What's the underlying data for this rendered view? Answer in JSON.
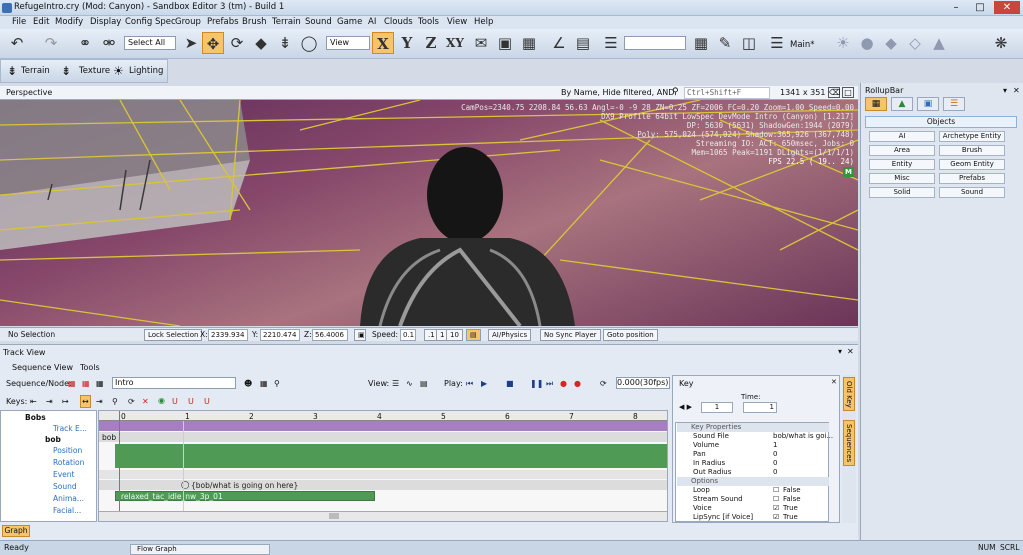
{
  "window": {
    "title": "RefugeIntro.cry (Mod: Canyon) - Sandbox Editor 3 (tm) - Build 1",
    "controls": [
      "minimize-icon",
      "maximize-icon",
      "close-icon"
    ]
  },
  "menu": [
    "File",
    "Edit",
    "Modify",
    "Display",
    "Config Spec",
    "Group",
    "Prefabs",
    "Brush",
    "Terrain",
    "Sound",
    "Game",
    "AI",
    "Clouds",
    "Tools",
    "View",
    "Help"
  ],
  "toolbar": {
    "select_all": "Select All",
    "coord_mode": "View",
    "axis_x": "X",
    "axis_y": "Y",
    "axis_z": "Z",
    "axis_xy": "XY",
    "layer": "Main*"
  },
  "toolbar2": {
    "terrain": "Terrain",
    "texture": "Texture",
    "lighting": "Lighting"
  },
  "viewport": {
    "name": "Perspective",
    "filter": "By Name, Hide filtered, AND",
    "search_placeholder": "Ctrl+Shift+F",
    "resolution": "1341 x 351",
    "hud": [
      "CamPos=2340.75 2208.84 56.63 Angl=-0 -9 28 ZN=0.25 ZF=2006 FC=0.20 Zoom=1.00 Speed=0.00",
      "DX9 Profile 64bit LowSpec DevMode Intro (Canyon) [1.217]",
      "DP: 5630 (5631) ShadowGen:1944 (2079)",
      "Poly: 575,024 (574,024) Shadow:365,926 (367,748)",
      "Streaming IO: ACT: 650msec, Jobs: 0",
      "Mem=1065 Peak=1191 DLights=(1/1/1/1)",
      "FPS  22.5 ( 19.. 24)"
    ],
    "hud_badge": "M"
  },
  "viewport_status": {
    "selection": "No Selection",
    "lock": "Lock Selection",
    "x_label": "X:",
    "x": "2339.934",
    "y_label": "Y:",
    "y": "2210.474",
    "z_label": "Z:",
    "z": "56.4006",
    "speed_label": "Speed:",
    "speeds": [
      "0.1",
      ".1",
      "1",
      "10"
    ],
    "ai_physics": "AI/Physics",
    "sync": "No Sync Player",
    "goto": "Goto position"
  },
  "trackview": {
    "title": "Track View",
    "menu": [
      "Sequence",
      "View",
      "Tools"
    ],
    "seq_label": "Sequence/Node:",
    "sequence": "Intro",
    "view_label": "View:",
    "play_label": "Play:",
    "time": "0.000(30fps)",
    "keys_label": "Keys:",
    "ruler": [
      "0",
      "1",
      "2",
      "3",
      "4",
      "5",
      "6",
      "7",
      "8"
    ],
    "tree": [
      "Bobs",
      "Track E...",
      "bob",
      "Position",
      "Rotation",
      "Event",
      "Sound",
      "Anima...",
      "Facial..."
    ],
    "timeline": {
      "row_label": "bob",
      "sound_key": "{bob/what is going on here}",
      "anim_key": "relaxed_tac_idle_nw_3p_01"
    },
    "tab": "Graph"
  },
  "keypanel": {
    "title": "Key",
    "time_label": "Time:",
    "key_index": "1",
    "time_value": "1",
    "section1": "Key Properties",
    "props": [
      {
        "name": "Sound File",
        "value": "bob/what is goi..."
      },
      {
        "name": "Volume",
        "value": "1"
      },
      {
        "name": "Pan",
        "value": "0"
      },
      {
        "name": "In Radius",
        "value": "0"
      },
      {
        "name": "Out Radius",
        "value": "0"
      }
    ],
    "section2": "Options",
    "options": [
      {
        "name": "Loop",
        "value": "False"
      },
      {
        "name": "Stream Sound",
        "value": "False"
      },
      {
        "name": "Voice",
        "value": "True"
      },
      {
        "name": "LipSync [if Voice]",
        "value": "True"
      }
    ],
    "side_tabs": [
      "Old Key",
      "Sequences"
    ]
  },
  "rollup": {
    "title": "RollupBar",
    "objects": "Objects",
    "buttons": [
      "AI",
      "Archetype Entity",
      "Area",
      "Brush",
      "Entity",
      "Geom Entity",
      "Misc",
      "Prefabs",
      "Solid",
      "Sound"
    ]
  },
  "statusbar": {
    "left": "Ready",
    "flow": "Flow Graph",
    "right": [
      "NUM",
      "SCRL"
    ]
  },
  "colors": {
    "accent": "#f5c46b",
    "wire": "#d8c43a",
    "bg": "#d4dbe6",
    "track_green": "#4f9a55",
    "track_purple": "#a57fc2"
  }
}
